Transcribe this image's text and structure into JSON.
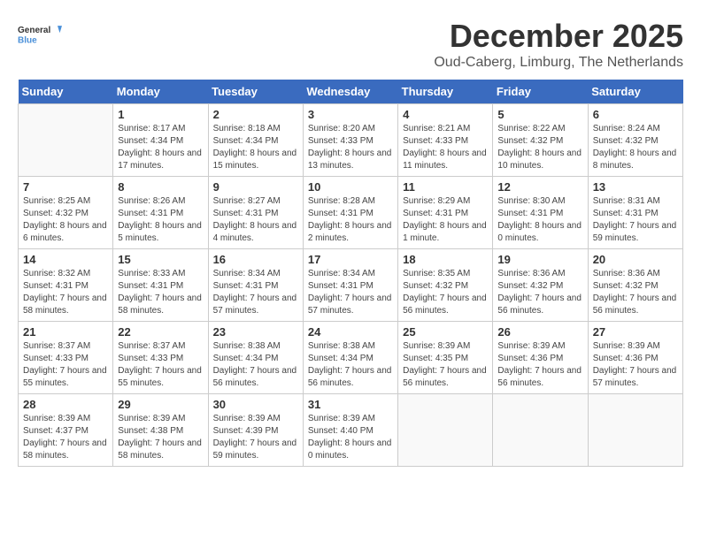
{
  "logo": {
    "general": "General",
    "blue": "Blue"
  },
  "header": {
    "month": "December 2025",
    "location": "Oud-Caberg, Limburg, The Netherlands"
  },
  "weekdays": [
    "Sunday",
    "Monday",
    "Tuesday",
    "Wednesday",
    "Thursday",
    "Friday",
    "Saturday"
  ],
  "weeks": [
    [
      {
        "day": "",
        "sunrise": "",
        "sunset": "",
        "daylight": ""
      },
      {
        "day": "1",
        "sunrise": "Sunrise: 8:17 AM",
        "sunset": "Sunset: 4:34 PM",
        "daylight": "Daylight: 8 hours and 17 minutes."
      },
      {
        "day": "2",
        "sunrise": "Sunrise: 8:18 AM",
        "sunset": "Sunset: 4:34 PM",
        "daylight": "Daylight: 8 hours and 15 minutes."
      },
      {
        "day": "3",
        "sunrise": "Sunrise: 8:20 AM",
        "sunset": "Sunset: 4:33 PM",
        "daylight": "Daylight: 8 hours and 13 minutes."
      },
      {
        "day": "4",
        "sunrise": "Sunrise: 8:21 AM",
        "sunset": "Sunset: 4:33 PM",
        "daylight": "Daylight: 8 hours and 11 minutes."
      },
      {
        "day": "5",
        "sunrise": "Sunrise: 8:22 AM",
        "sunset": "Sunset: 4:32 PM",
        "daylight": "Daylight: 8 hours and 10 minutes."
      },
      {
        "day": "6",
        "sunrise": "Sunrise: 8:24 AM",
        "sunset": "Sunset: 4:32 PM",
        "daylight": "Daylight: 8 hours and 8 minutes."
      }
    ],
    [
      {
        "day": "7",
        "sunrise": "Sunrise: 8:25 AM",
        "sunset": "Sunset: 4:32 PM",
        "daylight": "Daylight: 8 hours and 6 minutes."
      },
      {
        "day": "8",
        "sunrise": "Sunrise: 8:26 AM",
        "sunset": "Sunset: 4:31 PM",
        "daylight": "Daylight: 8 hours and 5 minutes."
      },
      {
        "day": "9",
        "sunrise": "Sunrise: 8:27 AM",
        "sunset": "Sunset: 4:31 PM",
        "daylight": "Daylight: 8 hours and 4 minutes."
      },
      {
        "day": "10",
        "sunrise": "Sunrise: 8:28 AM",
        "sunset": "Sunset: 4:31 PM",
        "daylight": "Daylight: 8 hours and 2 minutes."
      },
      {
        "day": "11",
        "sunrise": "Sunrise: 8:29 AM",
        "sunset": "Sunset: 4:31 PM",
        "daylight": "Daylight: 8 hours and 1 minute."
      },
      {
        "day": "12",
        "sunrise": "Sunrise: 8:30 AM",
        "sunset": "Sunset: 4:31 PM",
        "daylight": "Daylight: 8 hours and 0 minutes."
      },
      {
        "day": "13",
        "sunrise": "Sunrise: 8:31 AM",
        "sunset": "Sunset: 4:31 PM",
        "daylight": "Daylight: 7 hours and 59 minutes."
      }
    ],
    [
      {
        "day": "14",
        "sunrise": "Sunrise: 8:32 AM",
        "sunset": "Sunset: 4:31 PM",
        "daylight": "Daylight: 7 hours and 58 minutes."
      },
      {
        "day": "15",
        "sunrise": "Sunrise: 8:33 AM",
        "sunset": "Sunset: 4:31 PM",
        "daylight": "Daylight: 7 hours and 58 minutes."
      },
      {
        "day": "16",
        "sunrise": "Sunrise: 8:34 AM",
        "sunset": "Sunset: 4:31 PM",
        "daylight": "Daylight: 7 hours and 57 minutes."
      },
      {
        "day": "17",
        "sunrise": "Sunrise: 8:34 AM",
        "sunset": "Sunset: 4:31 PM",
        "daylight": "Daylight: 7 hours and 57 minutes."
      },
      {
        "day": "18",
        "sunrise": "Sunrise: 8:35 AM",
        "sunset": "Sunset: 4:32 PM",
        "daylight": "Daylight: 7 hours and 56 minutes."
      },
      {
        "day": "19",
        "sunrise": "Sunrise: 8:36 AM",
        "sunset": "Sunset: 4:32 PM",
        "daylight": "Daylight: 7 hours and 56 minutes."
      },
      {
        "day": "20",
        "sunrise": "Sunrise: 8:36 AM",
        "sunset": "Sunset: 4:32 PM",
        "daylight": "Daylight: 7 hours and 56 minutes."
      }
    ],
    [
      {
        "day": "21",
        "sunrise": "Sunrise: 8:37 AM",
        "sunset": "Sunset: 4:33 PM",
        "daylight": "Daylight: 7 hours and 55 minutes."
      },
      {
        "day": "22",
        "sunrise": "Sunrise: 8:37 AM",
        "sunset": "Sunset: 4:33 PM",
        "daylight": "Daylight: 7 hours and 55 minutes."
      },
      {
        "day": "23",
        "sunrise": "Sunrise: 8:38 AM",
        "sunset": "Sunset: 4:34 PM",
        "daylight": "Daylight: 7 hours and 56 minutes."
      },
      {
        "day": "24",
        "sunrise": "Sunrise: 8:38 AM",
        "sunset": "Sunset: 4:34 PM",
        "daylight": "Daylight: 7 hours and 56 minutes."
      },
      {
        "day": "25",
        "sunrise": "Sunrise: 8:39 AM",
        "sunset": "Sunset: 4:35 PM",
        "daylight": "Daylight: 7 hours and 56 minutes."
      },
      {
        "day": "26",
        "sunrise": "Sunrise: 8:39 AM",
        "sunset": "Sunset: 4:36 PM",
        "daylight": "Daylight: 7 hours and 56 minutes."
      },
      {
        "day": "27",
        "sunrise": "Sunrise: 8:39 AM",
        "sunset": "Sunset: 4:36 PM",
        "daylight": "Daylight: 7 hours and 57 minutes."
      }
    ],
    [
      {
        "day": "28",
        "sunrise": "Sunrise: 8:39 AM",
        "sunset": "Sunset: 4:37 PM",
        "daylight": "Daylight: 7 hours and 58 minutes."
      },
      {
        "day": "29",
        "sunrise": "Sunrise: 8:39 AM",
        "sunset": "Sunset: 4:38 PM",
        "daylight": "Daylight: 7 hours and 58 minutes."
      },
      {
        "day": "30",
        "sunrise": "Sunrise: 8:39 AM",
        "sunset": "Sunset: 4:39 PM",
        "daylight": "Daylight: 7 hours and 59 minutes."
      },
      {
        "day": "31",
        "sunrise": "Sunrise: 8:39 AM",
        "sunset": "Sunset: 4:40 PM",
        "daylight": "Daylight: 8 hours and 0 minutes."
      },
      {
        "day": "",
        "sunrise": "",
        "sunset": "",
        "daylight": ""
      },
      {
        "day": "",
        "sunrise": "",
        "sunset": "",
        "daylight": ""
      },
      {
        "day": "",
        "sunrise": "",
        "sunset": "",
        "daylight": ""
      }
    ]
  ]
}
